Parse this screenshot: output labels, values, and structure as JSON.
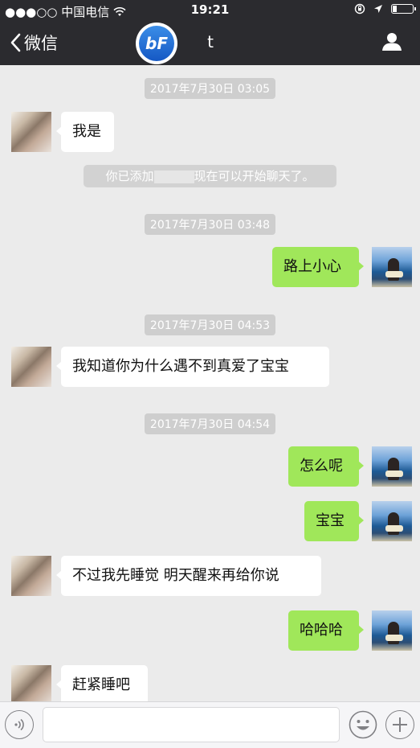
{
  "status_bar": {
    "carrier": "●●●○○ 中国电信",
    "time": "19:21"
  },
  "navbar": {
    "back_label": "微信",
    "logo_text": "bF",
    "title": "t"
  },
  "messages": [
    {
      "type": "timestamp",
      "text": "2017年7月30日 03:05"
    },
    {
      "type": "received",
      "text": "我是"
    },
    {
      "type": "system",
      "text_before": "你已添加",
      "text_after": "现在可以开始聊天了。"
    },
    {
      "type": "timestamp",
      "text": "2017年7月30日 03:48"
    },
    {
      "type": "sent",
      "text": "路上小心"
    },
    {
      "type": "timestamp",
      "text": "2017年7月30日 04:53"
    },
    {
      "type": "received",
      "text": "我知道你为什么遇不到真爱了宝宝"
    },
    {
      "type": "timestamp",
      "text": "2017年7月30日 04:54"
    },
    {
      "type": "sent",
      "text": "怎么呢"
    },
    {
      "type": "sent",
      "text": "宝宝"
    },
    {
      "type": "received",
      "text": "不过我先睡觉  明天醒来再给你说"
    },
    {
      "type": "sent",
      "text": "哈哈哈"
    },
    {
      "type": "received",
      "text": "赶紧睡吧"
    }
  ],
  "input_bar": {
    "value": "",
    "icons": [
      "voice-icon",
      "emoji-icon",
      "plus-icon"
    ]
  },
  "colors": {
    "header": "#2b2b2f",
    "background": "#ebebeb",
    "sent_bubble": "#a0e75a",
    "received_bubble": "#ffffff"
  }
}
